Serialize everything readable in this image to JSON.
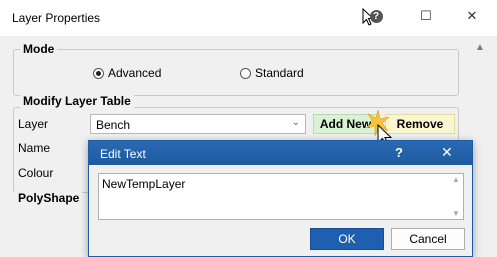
{
  "window": {
    "title": "Layer Properties",
    "help_glyph": "?",
    "maximize_glyph": "☐",
    "close_glyph": "✕"
  },
  "mode": {
    "group_label": "Mode",
    "options": [
      {
        "label": "Advanced",
        "selected": true
      },
      {
        "label": "Standard",
        "selected": false
      }
    ]
  },
  "modify_layer_table": {
    "group_label": "Modify Layer Table",
    "layer_label": "Layer",
    "layer_value": "Bench",
    "name_label": "Name",
    "colour_label": "Colour",
    "add_new_label": "Add New",
    "remove_label": "Remove"
  },
  "polyshape": {
    "group_label": "PolyShape"
  },
  "edit_text_dialog": {
    "title": "Edit Text",
    "help_glyph": "?",
    "close_glyph": "✕",
    "text_value": "NewTempLayer",
    "ok_label": "OK",
    "cancel_label": "Cancel"
  },
  "colors": {
    "dialog_titlebar": "#2563a8",
    "ok_button": "#1f5fb0",
    "add_new_bg": "#d9f3d2",
    "remove_bg": "#fbf6cf",
    "highlight_star": "#f5c542"
  }
}
